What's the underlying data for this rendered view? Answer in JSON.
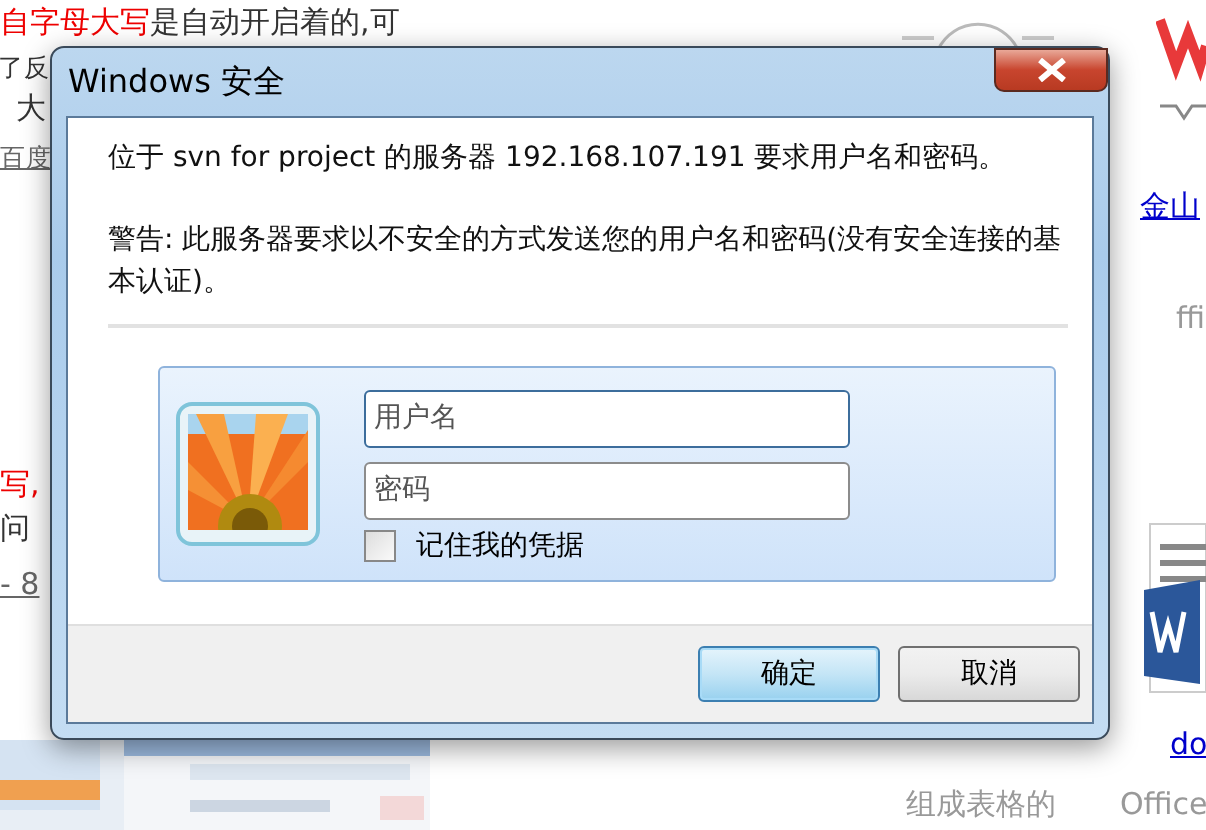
{
  "background_page": {
    "texts": [
      {
        "kind": "mixed",
        "segments": [
          {
            "text": "自字母大写",
            "kind": "highlight"
          },
          {
            "text": "是自动开启着的,可",
            "kind": "plain"
          }
        ]
      },
      {
        "kind": "plain",
        "text": "了反"
      },
      {
        "kind": "plain",
        "text": "大"
      },
      {
        "kind": "muted-link",
        "text": "百度"
      },
      {
        "kind": "highlight",
        "text": "写,"
      },
      {
        "kind": "plain",
        "text": "问"
      },
      {
        "kind": "muted-link",
        "text": "- 8"
      },
      {
        "kind": "link",
        "text": "金山"
      },
      {
        "kind": "muted",
        "text": "ffi"
      },
      {
        "kind": "link",
        "text": "do"
      },
      {
        "kind": "muted",
        "text": "组成表格的"
      },
      {
        "kind": "muted",
        "text": "Office"
      }
    ]
  },
  "dialog": {
    "title": "Windows 安全",
    "message": "位于 svn for project 的服务器 192.168.107.191 要求用户名和密码。",
    "warning": "警告: 此服务器要求以不安全的方式发送您的用户名和密码(没有安全连接的基本认证)。",
    "fields": [
      {
        "placeholder": "用户名",
        "focused": true
      },
      {
        "placeholder": "密码",
        "focused": false
      }
    ],
    "remember": {
      "label": "记住我的凭据",
      "checked": false
    },
    "buttons": [
      {
        "label": "确定",
        "default": true
      },
      {
        "label": "取消",
        "default": false
      }
    ]
  }
}
